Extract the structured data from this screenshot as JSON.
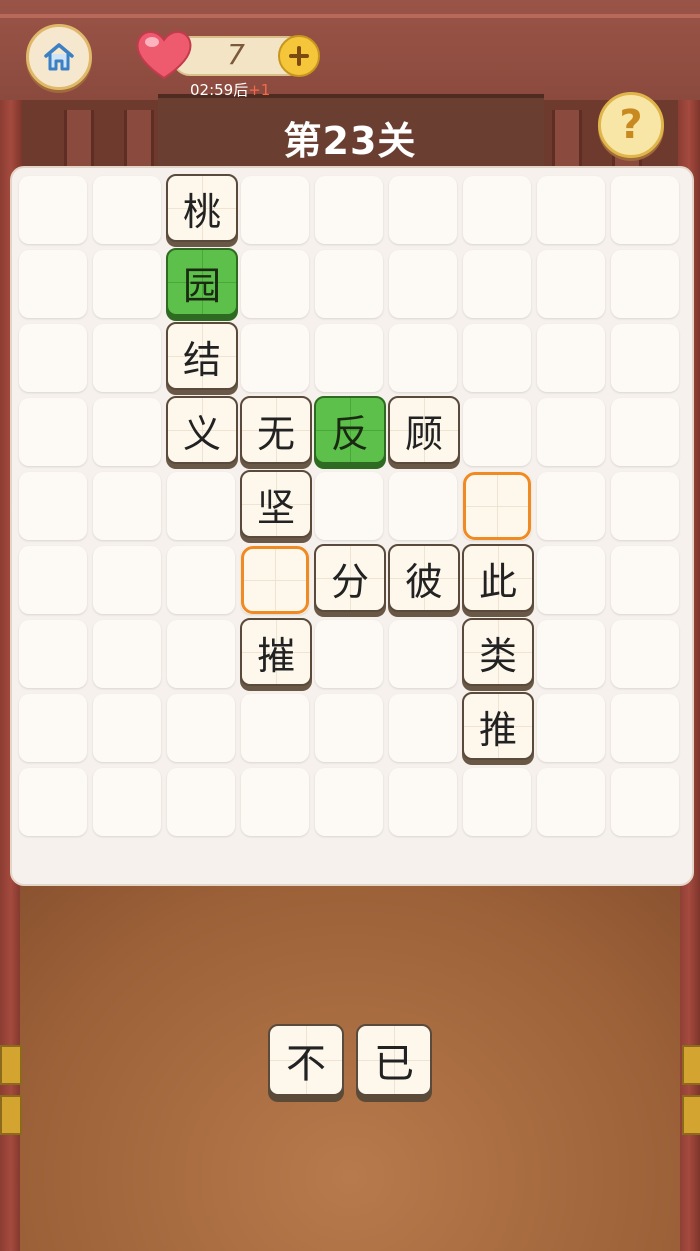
{
  "header": {
    "level_title": "第23关",
    "lives": "7",
    "timer": "02:59后",
    "timer_bonus": "+1",
    "help_symbol": "?"
  },
  "icons": {
    "home": "home-icon",
    "heart": "heart-icon",
    "plus": "plus-icon",
    "help": "question-icon"
  },
  "colors": {
    "accent_green": "#5cc04a",
    "slot_orange": "#f08a22",
    "frame_red": "#8b4a3e"
  },
  "board": {
    "columns": 9,
    "rows": 9,
    "tiles": [
      {
        "row": 0,
        "col": 2,
        "char": "桃",
        "state": "normal"
      },
      {
        "row": 1,
        "col": 2,
        "char": "园",
        "state": "correct"
      },
      {
        "row": 2,
        "col": 2,
        "char": "结",
        "state": "normal"
      },
      {
        "row": 3,
        "col": 2,
        "char": "义",
        "state": "normal"
      },
      {
        "row": 3,
        "col": 3,
        "char": "无",
        "state": "normal"
      },
      {
        "row": 3,
        "col": 4,
        "char": "反",
        "state": "correct"
      },
      {
        "row": 3,
        "col": 5,
        "char": "顾",
        "state": "normal"
      },
      {
        "row": 4,
        "col": 3,
        "char": "坚",
        "state": "normal"
      },
      {
        "row": 5,
        "col": 4,
        "char": "分",
        "state": "normal"
      },
      {
        "row": 5,
        "col": 5,
        "char": "彼",
        "state": "normal"
      },
      {
        "row": 5,
        "col": 6,
        "char": "此",
        "state": "normal"
      },
      {
        "row": 6,
        "col": 3,
        "char": "摧",
        "state": "normal"
      },
      {
        "row": 6,
        "col": 6,
        "char": "类",
        "state": "normal"
      },
      {
        "row": 7,
        "col": 6,
        "char": "推",
        "state": "normal"
      }
    ],
    "empty_slots": [
      {
        "row": 4,
        "col": 6
      },
      {
        "row": 5,
        "col": 3
      }
    ]
  },
  "choices": [
    "不",
    "已"
  ]
}
